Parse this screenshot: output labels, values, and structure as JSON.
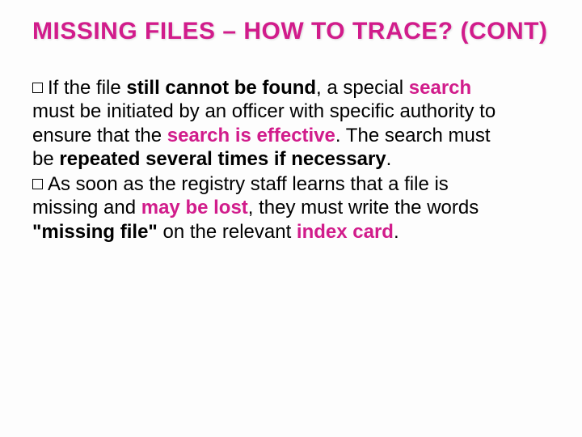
{
  "title": "MISSING FILES – HOW TO TRACE? (CONT)",
  "bullets": [
    {
      "runs": [
        {
          "t": "If the file ",
          "cls": ""
        },
        {
          "t": "still cannot be found",
          "cls": "bold"
        },
        {
          "t": ", a special ",
          "cls": ""
        },
        {
          "t": "search",
          "cls": "hl"
        },
        {
          "t": " must be initiated by an officer with specific authority to ensure that the ",
          "cls": ""
        },
        {
          "t": "search is effective",
          "cls": "hl"
        },
        {
          "t": ". The search must be ",
          "cls": ""
        },
        {
          "t": "repeated several times if necessary",
          "cls": "bold"
        },
        {
          "t": ".",
          "cls": ""
        }
      ]
    },
    {
      "runs": [
        {
          "t": "As soon as the registry staff learns that a file is missing and ",
          "cls": ""
        },
        {
          "t": "may be lost",
          "cls": "hl"
        },
        {
          "t": ", they must write the words ",
          "cls": ""
        },
        {
          "t": "\"missing file\" ",
          "cls": "bold"
        },
        {
          "t": "on the relevant ",
          "cls": ""
        },
        {
          "t": "index card",
          "cls": "hl"
        },
        {
          "t": ".",
          "cls": ""
        }
      ]
    }
  ]
}
